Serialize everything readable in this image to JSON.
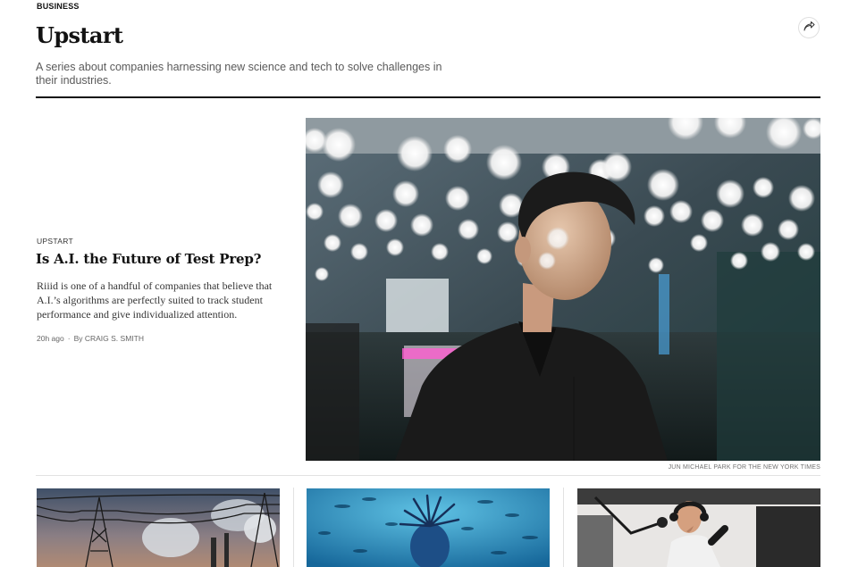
{
  "section": {
    "label": "BUSINESS"
  },
  "header": {
    "title": "Upstart",
    "description": "A series about companies harnessing new science and tech to solve challenges in their industries.",
    "share_icon": "share-icon"
  },
  "lead_story": {
    "kicker": "UPSTART",
    "headline": "Is A.I. the Future of Test Prep?",
    "summary": "Riiid is one of a handful of companies that believe that A.I.’s algorithms are perfectly suited to track student performance and give individualized attention.",
    "time": "20h ago",
    "separator": "·",
    "byline": "By CRAIG S. SMITH",
    "image_credit": "JUN MICHAEL PARK FOR THE NEW YORK TIMES"
  },
  "colors": {
    "rule": "#121212",
    "divider": "#e2e2e2",
    "text": "#121212",
    "muted": "#5a5a5a"
  }
}
